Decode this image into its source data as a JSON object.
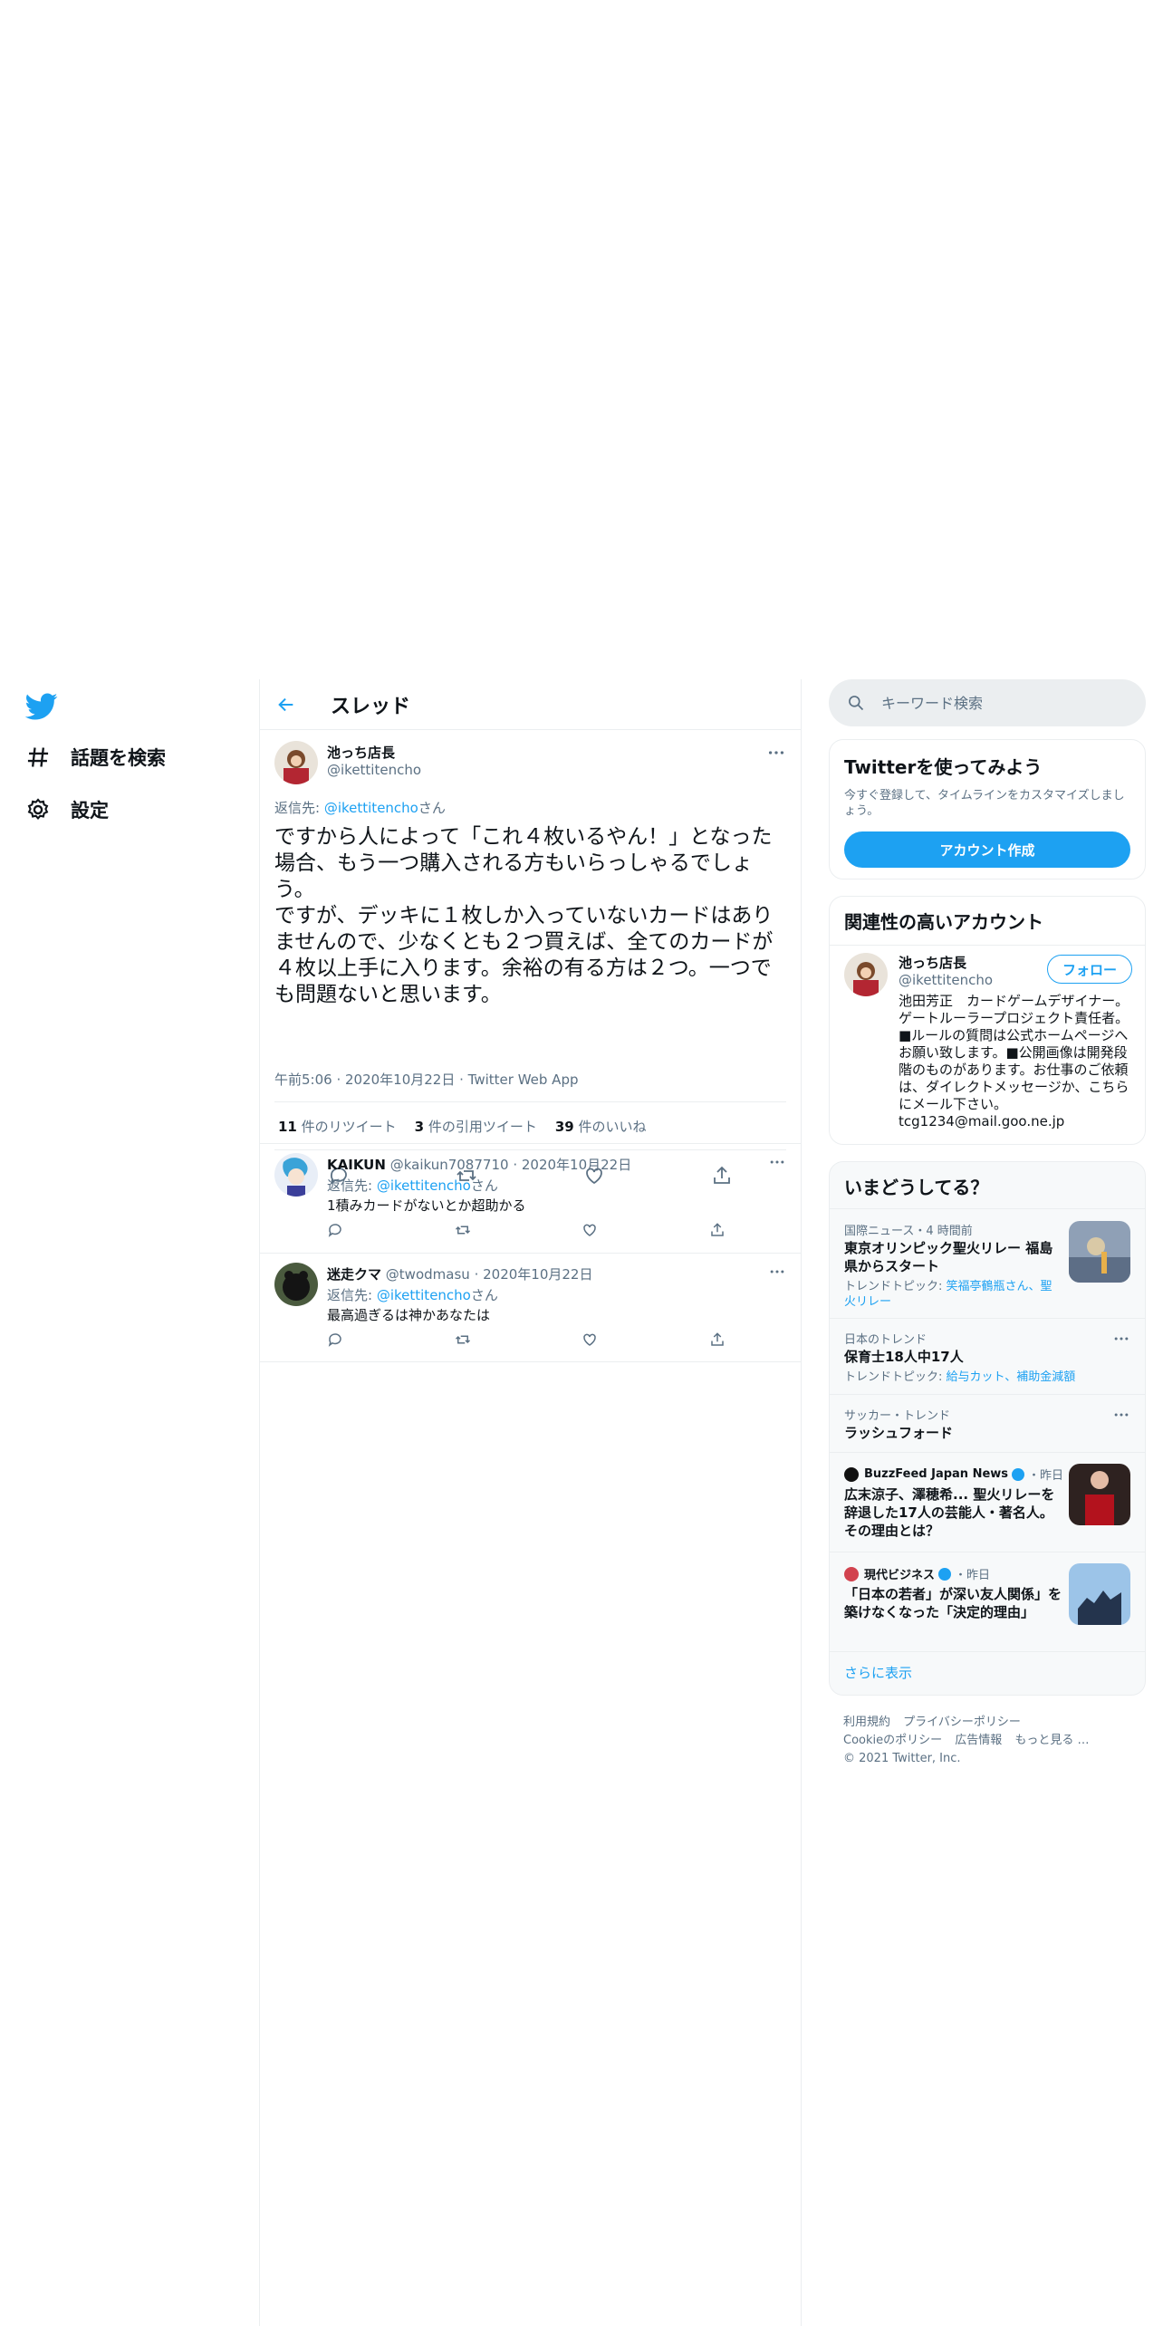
{
  "nav": {
    "explore_label": "話題を検索",
    "settings_label": "設定"
  },
  "header": {
    "title": "スレッド"
  },
  "main_tweet": {
    "name": "池っち店長",
    "handle": "@ikettitencho",
    "reply_prefix": "返信先: ",
    "reply_handle": "@ikettitencho",
    "reply_suffix": "さん",
    "text": "ですから人によって「これ４枚いるやん！」となった場合、もう一つ購入される方もいらっしゃるでしょう。\nですが、デッキに１枚しか入っていないカードはありませんので、少なくとも２つ買えば、全てのカードが４枚以上手に入ります。余裕の有る方は２つ。一つでも問題ないと思います。",
    "time": "午前5:06",
    "date": "2020年10月22日",
    "client": "Twitter Web App",
    "retweets_count": "11",
    "retweets_label": " 件のリツイート",
    "quotes_count": "3",
    "quotes_label": " 件の引用ツイート",
    "likes_count": "39",
    "likes_label": " 件のいいね"
  },
  "replies": [
    {
      "name": "KAIKUN",
      "handle": "@kaikun7087710",
      "date": "2020年10月22日",
      "reply_prefix": "返信先: ",
      "reply_handle": "@ikettitencho",
      "reply_suffix": "さん",
      "text": "1積みカードがないとか超助かる"
    },
    {
      "name": "迷走クマ",
      "handle": "@twodmasu",
      "date": "2020年10月22日",
      "reply_prefix": "返信先: ",
      "reply_handle": "@ikettitencho",
      "reply_suffix": "さん",
      "text": "最高過ぎるは神かあなたは"
    }
  ],
  "search": {
    "placeholder": "キーワード検索"
  },
  "join": {
    "title": "Twitterを使ってみよう",
    "subtitle": "今すぐ登録して、タイムラインをカスタマイズしましょう。",
    "button": "アカウント作成"
  },
  "related": {
    "title": "関連性の高いアカウント",
    "name": "池っち店長",
    "handle": "@ikettitencho",
    "follow": "フォロー",
    "bio": "池田芳正　カードゲームデザイナー。ゲートルーラープロジェクト責任者。■ルールの質問は公式ホームページへお願い致します。■公開画像は開発段階のものがあります。お仕事のご依頼は、ダイレクトメッセージか、こちらにメール下さい。 tcg1234@mail.goo.ne.jp"
  },
  "trends": {
    "title": "いまどうしてる？",
    "items": [
      {
        "context": "国際ニュース・4 時間前",
        "title": "東京オリンピック聖火リレー 福島県からスタート",
        "sub_prefix": "トレンドトピック: ",
        "sub_links": "笑福亭鶴瓶さん、聖火リレー"
      },
      {
        "context": "日本のトレンド",
        "title": "保育士18人中17人",
        "sub_prefix": "トレンドトピック: ",
        "sub_links": "給与カット、補助金減額"
      },
      {
        "context": "サッカー・トレンド",
        "title": "ラッシュフォード"
      },
      {
        "source": "BuzzFeed Japan News",
        "time": "・昨日",
        "title": "広末涼子、澤穂希... 聖火リレーを辞退した17人の芸能人・著名人。その理由とは？"
      },
      {
        "source": "現代ビジネス",
        "time": "・昨日",
        "title": "「日本の若者」が深い友人関係」を築けなくなった「決定的理由」"
      }
    ],
    "show_more": "さらに表示"
  },
  "footer": {
    "links_row1": [
      "利用規約",
      "プライバシーポリシー"
    ],
    "links_row2": [
      "Cookieのポリシー",
      "広告情報",
      "もっと見る …"
    ],
    "copyright": "© 2021 Twitter, Inc."
  },
  "colors": {
    "accent": "#1da1f2",
    "text": "#0f1419",
    "secondary": "#5b7083",
    "border": "#ebeef0"
  }
}
